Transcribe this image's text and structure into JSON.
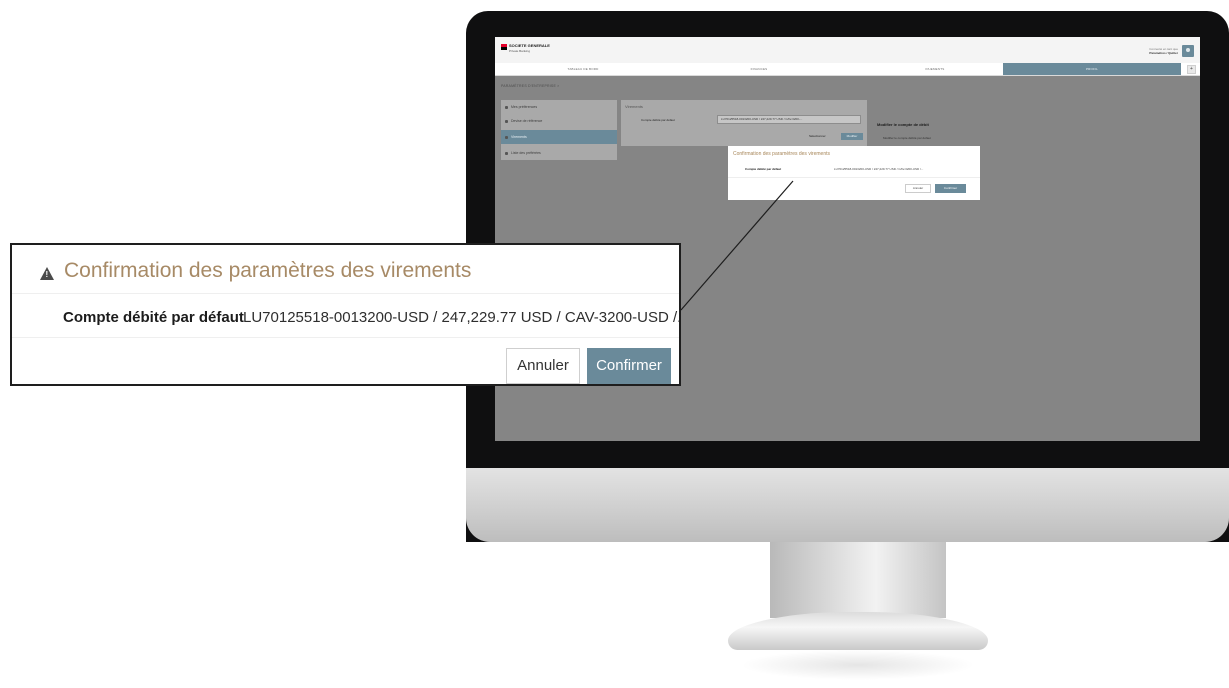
{
  "header": {
    "brand": "SOCIETE GENERALE",
    "brand_sub": "Private Banking",
    "user_line1": "Connecté en tant que",
    "user_line2": "Paramètres / Quitter"
  },
  "nav": {
    "tabs": [
      {
        "label": "TABLEAU DE BORD"
      },
      {
        "label": "FINANCES"
      },
      {
        "label": "PAIEMENTS"
      },
      {
        "label": "PROFIL"
      }
    ],
    "plus": "+"
  },
  "breadcrumb": "PARAMÈTRES D'ENTREPRISE  >",
  "sidebar": {
    "items": [
      {
        "label": "Mes préférences"
      },
      {
        "label": "Devise de référence"
      },
      {
        "label": "Virements"
      },
      {
        "label": "Liste des préférées"
      }
    ]
  },
  "panel": {
    "title": "Virements",
    "label": "Compte débité par défaut",
    "select_value": "LU70125518-0013200-USD / 247,229.77 USD / CAV-3200-...",
    "cancel": "Sélectionner",
    "save": "Modifier",
    "side_title": "Modifier le compte de débit",
    "side_sub": "Modifier le compte débité par défaut"
  },
  "dialog": {
    "title": "Confirmation des paramètres des virements",
    "field_label": "Compte débité par défaut",
    "field_value": "LU70125518-0013200-USD / 247,229.77 USD / CAV-3200-USD /...",
    "cancel_label": "Annuler",
    "confirm_label": "Confirmer"
  },
  "colors": {
    "accent": "#6a8a9a",
    "title_gold": "#a78a66",
    "brand_red": "#e4002b"
  },
  "icons": {
    "warning": "warning-triangle-icon"
  }
}
